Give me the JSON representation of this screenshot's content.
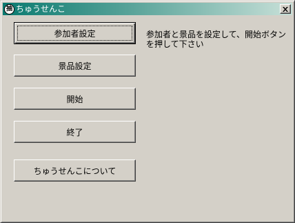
{
  "window": {
    "icon_char": "抽",
    "title": "ちゅうせんこ",
    "close_label": "×"
  },
  "buttons": {
    "participants": "参加者設定",
    "prizes": "景品設定",
    "start": "開始",
    "exit": "終了",
    "about": "ちゅうせんこについて"
  },
  "message": "参加者と景品を設定して、開始ボタンを押して下さい",
  "colors": {
    "face": "#d4d0c8",
    "title_gradient_start": "#0a7a70",
    "title_gradient_end": "#c8e0d8",
    "title_text": "#ffffff"
  }
}
